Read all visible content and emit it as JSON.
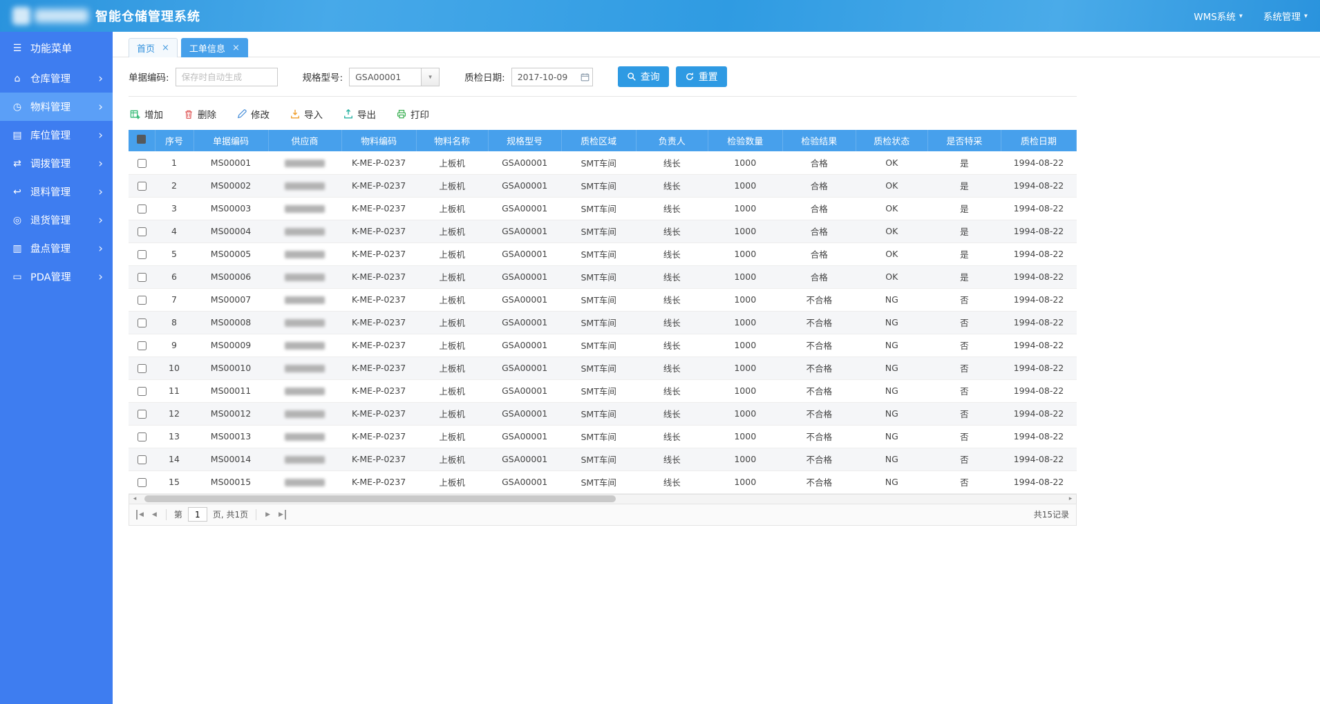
{
  "icons": {
    "close": "×",
    "caret_down": "▾",
    "chevron_right": "›",
    "menu": "☰",
    "dropdown_arrow": "▼",
    "scroll_left": "◂",
    "scroll_right": "▸",
    "page_prev": "◀",
    "page_next": "▶"
  },
  "topbar": {
    "title": "智能仓储管理系统",
    "menus": [
      {
        "label": "WMS系统"
      },
      {
        "label": "系统管理"
      }
    ]
  },
  "sidebar": {
    "header": "功能菜单",
    "items": [
      {
        "label": "仓库管理",
        "icon": "warehouse-icon",
        "glyph": "⌂",
        "active": false
      },
      {
        "label": "物料管理",
        "icon": "material-icon",
        "glyph": "◷",
        "active": true
      },
      {
        "label": "库位管理",
        "icon": "location-icon",
        "glyph": "▤",
        "active": false
      },
      {
        "label": "调拨管理",
        "icon": "transfer-icon",
        "glyph": "⇄",
        "active": false
      },
      {
        "label": "退料管理",
        "icon": "return-material-icon",
        "glyph": "↩",
        "active": false
      },
      {
        "label": "退货管理",
        "icon": "return-goods-icon",
        "glyph": "◎",
        "active": false
      },
      {
        "label": "盘点管理",
        "icon": "inventory-icon",
        "glyph": "▥",
        "active": false
      },
      {
        "label": "PDA管理",
        "icon": "pda-icon",
        "glyph": "▭",
        "active": false
      }
    ]
  },
  "tabs": [
    {
      "label": "首页",
      "active": false
    },
    {
      "label": "工单信息",
      "active": true
    }
  ],
  "filters": {
    "doc": {
      "label": "单据编码:",
      "placeholder": "保存时自动生成"
    },
    "spec": {
      "label": "规格型号:",
      "value": "GSA00001"
    },
    "date": {
      "label": "质检日期:",
      "value": "2017-10-09"
    },
    "search": "查询",
    "reset": "重置"
  },
  "toolbar": [
    {
      "label": "增加",
      "icon": "add-icon"
    },
    {
      "label": "删除",
      "icon": "delete-icon"
    },
    {
      "label": "修改",
      "icon": "edit-icon"
    },
    {
      "label": "导入",
      "icon": "import-icon"
    },
    {
      "label": "导出",
      "icon": "export-icon"
    },
    {
      "label": "打印",
      "icon": "print-icon"
    }
  ],
  "table": {
    "columns": [
      "序号",
      "单据编码",
      "供应商",
      "物料编码",
      "物料名称",
      "规格型号",
      "质检区域",
      "负责人",
      "检验数量",
      "检验结果",
      "质检状态",
      "是否特采",
      "质检日期"
    ],
    "rows": [
      {
        "seq": "1",
        "doc": "MS00001",
        "supplier": "",
        "material_code": "K-ME-P-0237",
        "material_name": "上板机",
        "spec": "GSA00001",
        "area": "SMT车间",
        "owner": "线长",
        "qty": "1000",
        "result": "合格",
        "status": "OK",
        "special": "是",
        "date": "1994-08-22"
      },
      {
        "seq": "2",
        "doc": "MS00002",
        "supplier": "",
        "material_code": "K-ME-P-0237",
        "material_name": "上板机",
        "spec": "GSA00001",
        "area": "SMT车间",
        "owner": "线长",
        "qty": "1000",
        "result": "合格",
        "status": "OK",
        "special": "是",
        "date": "1994-08-22"
      },
      {
        "seq": "3",
        "doc": "MS00003",
        "supplier": "",
        "material_code": "K-ME-P-0237",
        "material_name": "上板机",
        "spec": "GSA00001",
        "area": "SMT车间",
        "owner": "线长",
        "qty": "1000",
        "result": "合格",
        "status": "OK",
        "special": "是",
        "date": "1994-08-22"
      },
      {
        "seq": "4",
        "doc": "MS00004",
        "supplier": "",
        "material_code": "K-ME-P-0237",
        "material_name": "上板机",
        "spec": "GSA00001",
        "area": "SMT车间",
        "owner": "线长",
        "qty": "1000",
        "result": "合格",
        "status": "OK",
        "special": "是",
        "date": "1994-08-22"
      },
      {
        "seq": "5",
        "doc": "MS00005",
        "supplier": "",
        "material_code": "K-ME-P-0237",
        "material_name": "上板机",
        "spec": "GSA00001",
        "area": "SMT车间",
        "owner": "线长",
        "qty": "1000",
        "result": "合格",
        "status": "OK",
        "special": "是",
        "date": "1994-08-22"
      },
      {
        "seq": "6",
        "doc": "MS00006",
        "supplier": "",
        "material_code": "K-ME-P-0237",
        "material_name": "上板机",
        "spec": "GSA00001",
        "area": "SMT车间",
        "owner": "线长",
        "qty": "1000",
        "result": "合格",
        "status": "OK",
        "special": "是",
        "date": "1994-08-22"
      },
      {
        "seq": "7",
        "doc": "MS00007",
        "supplier": "",
        "material_code": "K-ME-P-0237",
        "material_name": "上板机",
        "spec": "GSA00001",
        "area": "SMT车间",
        "owner": "线长",
        "qty": "1000",
        "result": "不合格",
        "status": "NG",
        "special": "否",
        "date": "1994-08-22"
      },
      {
        "seq": "8",
        "doc": "MS00008",
        "supplier": "",
        "material_code": "K-ME-P-0237",
        "material_name": "上板机",
        "spec": "GSA00001",
        "area": "SMT车间",
        "owner": "线长",
        "qty": "1000",
        "result": "不合格",
        "status": "NG",
        "special": "否",
        "date": "1994-08-22"
      },
      {
        "seq": "9",
        "doc": "MS00009",
        "supplier": "",
        "material_code": "K-ME-P-0237",
        "material_name": "上板机",
        "spec": "GSA00001",
        "area": "SMT车间",
        "owner": "线长",
        "qty": "1000",
        "result": "不合格",
        "status": "NG",
        "special": "否",
        "date": "1994-08-22"
      },
      {
        "seq": "10",
        "doc": "MS00010",
        "supplier": "",
        "material_code": "K-ME-P-0237",
        "material_name": "上板机",
        "spec": "GSA00001",
        "area": "SMT车间",
        "owner": "线长",
        "qty": "1000",
        "result": "不合格",
        "status": "NG",
        "special": "否",
        "date": "1994-08-22"
      },
      {
        "seq": "11",
        "doc": "MS00011",
        "supplier": "",
        "material_code": "K-ME-P-0237",
        "material_name": "上板机",
        "spec": "GSA00001",
        "area": "SMT车间",
        "owner": "线长",
        "qty": "1000",
        "result": "不合格",
        "status": "NG",
        "special": "否",
        "date": "1994-08-22"
      },
      {
        "seq": "12",
        "doc": "MS00012",
        "supplier": "",
        "material_code": "K-ME-P-0237",
        "material_name": "上板机",
        "spec": "GSA00001",
        "area": "SMT车间",
        "owner": "线长",
        "qty": "1000",
        "result": "不合格",
        "status": "NG",
        "special": "否",
        "date": "1994-08-22"
      },
      {
        "seq": "13",
        "doc": "MS00013",
        "supplier": "",
        "material_code": "K-ME-P-0237",
        "material_name": "上板机",
        "spec": "GSA00001",
        "area": "SMT车间",
        "owner": "线长",
        "qty": "1000",
        "result": "不合格",
        "status": "NG",
        "special": "否",
        "date": "1994-08-22"
      },
      {
        "seq": "14",
        "doc": "MS00014",
        "supplier": "",
        "material_code": "K-ME-P-0237",
        "material_name": "上板机",
        "spec": "GSA00001",
        "area": "SMT车间",
        "owner": "线长",
        "qty": "1000",
        "result": "不合格",
        "status": "NG",
        "special": "否",
        "date": "1994-08-22"
      },
      {
        "seq": "15",
        "doc": "MS00015",
        "supplier": "",
        "material_code": "K-ME-P-0237",
        "material_name": "上板机",
        "spec": "GSA00001",
        "area": "SMT车间",
        "owner": "线长",
        "qty": "1000",
        "result": "不合格",
        "status": "NG",
        "special": "否",
        "date": "1994-08-22"
      }
    ]
  },
  "pagination": {
    "page_prefix": "第",
    "page_value": "1",
    "page_suffix": "页, 共1页",
    "total": "共15记录"
  }
}
